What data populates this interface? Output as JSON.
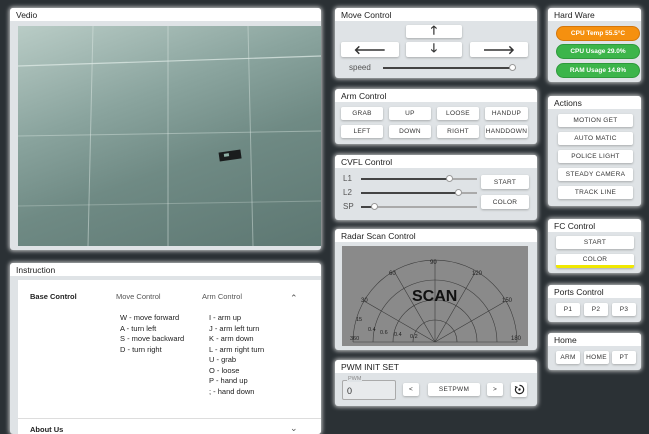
{
  "vedio": {
    "title": "Vedio"
  },
  "move_control": {
    "title": "Move Control",
    "up_arrow": "🡑",
    "left_arrow": "🡐",
    "down_arrow": "🡓",
    "right_arrow": "🡒",
    "speed_label": "speed",
    "speed_value": 0.97
  },
  "arm_control": {
    "title": "Arm Control",
    "buttons": [
      "GRAB",
      "UP",
      "LOOSE",
      "HANDUP",
      "LEFT",
      "DOWN",
      "RIGHT",
      "HANDDOWN"
    ]
  },
  "cvfl_control": {
    "title": "CVFL Control",
    "sliders": [
      {
        "label": "L1",
        "value": 0.76
      },
      {
        "label": "L2",
        "value": 0.84
      },
      {
        "label": "SP",
        "value": 0.11
      }
    ],
    "start_label": "START",
    "color_label": "COLOR"
  },
  "radar": {
    "title": "Radar Scan Control",
    "scan_label": "SCAN",
    "angle_labels": [
      "30",
      "60",
      "90",
      "120",
      "150",
      "180"
    ],
    "range_labels": [
      "0.4",
      "0.6",
      "0.4",
      "0.2"
    ],
    "left_ticks": [
      "15",
      "360"
    ]
  },
  "pwm": {
    "title": "PWM INIT SET",
    "field_label": "PWM",
    "field_value": "0",
    "dec_label": "<",
    "set_label": "SETPWM",
    "inc_label": ">"
  },
  "hardware": {
    "title": "Hard Ware",
    "cpu_temp": "CPU Temp 55.5°C",
    "cpu_usage": "CPU Usage 29.0%",
    "ram_usage": "RAM Usage 14.8%",
    "colors": {
      "temp": "#f5900f",
      "usage": "#3cb54a"
    }
  },
  "actions": {
    "title": "Actions",
    "buttons": [
      "MOTION GET",
      "AUTO MATIC",
      "POLICE LIGHT",
      "STEADY CAMERA",
      "TRACK LINE"
    ]
  },
  "fc_control": {
    "title": "FC Control",
    "start_label": "START",
    "color_label": "COLOR",
    "accent": "#f0e800"
  },
  "ports": {
    "title": "Ports Control",
    "buttons": [
      "P1",
      "P2",
      "P3"
    ]
  },
  "home": {
    "title": "Home",
    "buttons": [
      "ARM",
      "HOME",
      "PT"
    ]
  },
  "instruction": {
    "title": "Instruction",
    "headers": [
      "Base Control",
      "Move Control",
      "Arm Control"
    ],
    "move_lines": [
      "W - move forward",
      "A - turn left",
      "S - move backward",
      "D - turn right"
    ],
    "arm_lines": [
      "I - arm up",
      "J - arm left turn",
      "K - arm down",
      "L - arm right turn",
      "U - grab",
      "O - loose",
      "P - hand up",
      "; - hand down"
    ],
    "about_label": "About Us",
    "collapse_icon": "⌃",
    "expand_icon": "⌄"
  }
}
